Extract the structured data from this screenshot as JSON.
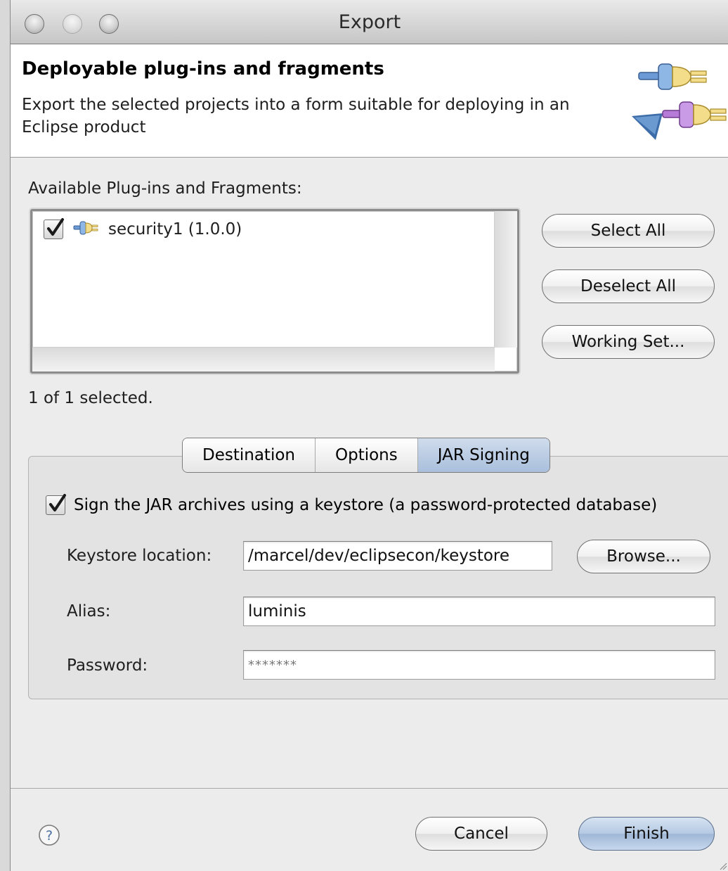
{
  "window": {
    "title": "Export"
  },
  "header": {
    "title": "Deployable plug-ins and fragments",
    "description": "Export the selected projects into a form suitable for deploying in an Eclipse product"
  },
  "plugins": {
    "label": "Available Plug-ins and Fragments:",
    "items": [
      {
        "label": "security1 (1.0.0)",
        "checked": true,
        "icon": "plugin-icon"
      }
    ],
    "status": "1 of 1 selected."
  },
  "list_buttons": {
    "select_all": "Select All",
    "deselect_all": "Deselect All",
    "working_set": "Working Set..."
  },
  "tabs": {
    "items": [
      "Destination",
      "Options",
      "JAR Signing"
    ],
    "active": "JAR Signing"
  },
  "jar_signing": {
    "sign_label": "Sign the JAR archives using a keystore (a password-protected database)",
    "sign_checked": true,
    "keystore_label": "Keystore location:",
    "keystore_value": "/marcel/dev/eclipsecon/keystore",
    "browse_label": "Browse...",
    "alias_label": "Alias:",
    "alias_value": "luminis",
    "password_label": "Password:",
    "password_value": "*******"
  },
  "footer": {
    "cancel_label": "Cancel",
    "finish_label": "Finish"
  },
  "colors": {
    "window_bg": "#ececec",
    "default_button": "#b5c9e2",
    "active_tab": "#b9cbe3"
  }
}
